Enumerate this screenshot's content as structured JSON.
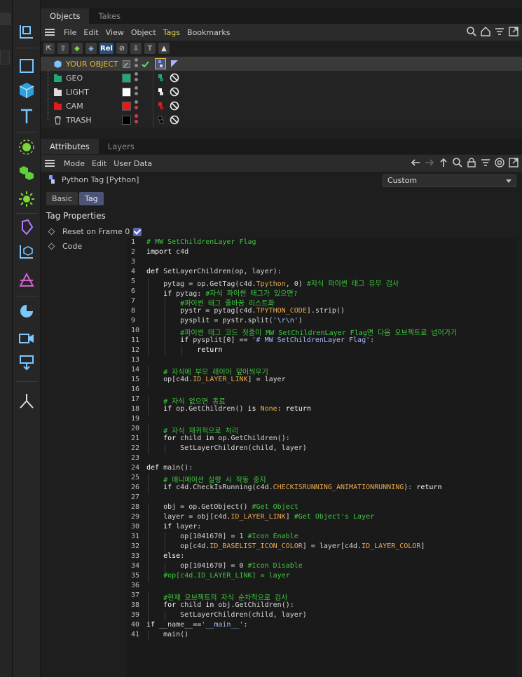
{
  "tabs_top": [
    "Objects",
    "Takes"
  ],
  "obj_menu": [
    "File",
    "Edit",
    "View",
    "Object",
    "Tags",
    "Bookmarks"
  ],
  "obj_toolbar_label": "Rel",
  "objects": [
    {
      "name": "YOUR OBJECT",
      "color": "",
      "selected": true
    },
    {
      "name": "GEO",
      "color": "#1fa87a",
      "selected": false
    },
    {
      "name": "LIGHT",
      "color": "#ffffff",
      "selected": false
    },
    {
      "name": "CAM",
      "color": "#e51b1b",
      "selected": false
    },
    {
      "name": "TRASH",
      "color": "#000000",
      "selected": false
    }
  ],
  "attr_tabs": [
    "Attributes",
    "Layers"
  ],
  "attr_menu": [
    "Mode",
    "Edit",
    "User Data"
  ],
  "tag_title": "Python Tag [Python]",
  "preset": "Custom",
  "subtabs": [
    "Basic",
    "Tag"
  ],
  "section_title": "Tag Properties",
  "props": [
    "Reset on Frame 0",
    "Code"
  ],
  "code_lines": [
    [
      [
        "cm",
        "# MW SetChildrenLayer Flag"
      ]
    ],
    [
      [
        "k",
        "import"
      ],
      [
        "fn",
        " c4d"
      ]
    ],
    [],
    [
      [
        "k",
        "def"
      ],
      [
        "fn",
        " SetLayerChildren(op, layer):"
      ]
    ],
    [
      [
        "fn",
        "    pytag = op.GetTag(c4d."
      ],
      [
        "cst",
        "Tpython"
      ],
      [
        "fn",
        ", 0) "
      ],
      [
        "cm",
        "#자식 파이썬 태그 유무 검사"
      ]
    ],
    [
      [
        "fn",
        "    "
      ],
      [
        "k",
        "if"
      ],
      [
        "fn",
        " pytag: "
      ],
      [
        "cm",
        "#자식 파이썬 태그가 있으면?"
      ]
    ],
    [
      [
        "fn",
        "        "
      ],
      [
        "cm",
        "#파이썬 태그 줄바꿈 리스트화"
      ]
    ],
    [
      [
        "fn",
        "        pystr = pytag[c4d."
      ],
      [
        "cst",
        "TPYTHON_CODE"
      ],
      [
        "fn",
        "].strip()"
      ]
    ],
    [
      [
        "fn",
        "        pysplit = pystr.split("
      ],
      [
        "str",
        "'\\r\\n'"
      ],
      [
        "fn",
        ")"
      ]
    ],
    [
      [
        "fn",
        "        "
      ],
      [
        "cm",
        "#파이썬 태그 코드 첫줄이 MW SetChildrenLayer Flag면 다음 오브젝트로 넘어가기"
      ]
    ],
    [
      [
        "fn",
        "        "
      ],
      [
        "k",
        "if"
      ],
      [
        "fn",
        " pysplit[0] == "
      ],
      [
        "str",
        "'# MW SetChildrenLayer Flag'"
      ],
      [
        "fn",
        ":"
      ]
    ],
    [
      [
        "fn",
        "            "
      ],
      [
        "k",
        "return"
      ]
    ],
    [],
    [
      [
        "fn",
        "    "
      ],
      [
        "cm",
        "# 자식에 부모 레이어 덮어씌우기"
      ]
    ],
    [
      [
        "fn",
        "    op[c4d."
      ],
      [
        "cst",
        "ID_LAYER_LINK"
      ],
      [
        "fn",
        "] = layer"
      ]
    ],
    [],
    [
      [
        "fn",
        "    "
      ],
      [
        "cm",
        "# 자식 없으면 종료"
      ]
    ],
    [
      [
        "fn",
        "    "
      ],
      [
        "k",
        "if"
      ],
      [
        "fn",
        " op.GetChildren() "
      ],
      [
        "k",
        "is"
      ],
      [
        "fn",
        " "
      ],
      [
        "cst",
        "None"
      ],
      [
        "fn",
        ": "
      ],
      [
        "k",
        "return"
      ]
    ],
    [],
    [
      [
        "fn",
        "    "
      ],
      [
        "cm",
        "# 자식 재귀적으로 처리"
      ]
    ],
    [
      [
        "fn",
        "    "
      ],
      [
        "k",
        "for"
      ],
      [
        "fn",
        " child "
      ],
      [
        "k",
        "in"
      ],
      [
        "fn",
        " op.GetChildren():"
      ]
    ],
    [
      [
        "fn",
        "        SetLayerChildren(child, layer)"
      ]
    ],
    [],
    [
      [
        "k",
        "def"
      ],
      [
        "fn",
        " main():"
      ]
    ],
    [
      [
        "fn",
        "    "
      ],
      [
        "cm",
        "# 애니메이션 실행 시 작동 중지"
      ]
    ],
    [
      [
        "fn",
        "    "
      ],
      [
        "k",
        "if"
      ],
      [
        "fn",
        " c4d.CheckIsRunning(c4d."
      ],
      [
        "cst",
        "CHECKISRUNNING_ANIMATIONRUNNING"
      ],
      [
        "fn",
        "): "
      ],
      [
        "k",
        "return"
      ]
    ],
    [],
    [
      [
        "fn",
        "    obj = op.GetObject() "
      ],
      [
        "cm",
        "#Get Object"
      ]
    ],
    [
      [
        "fn",
        "    layer = obj[c4d."
      ],
      [
        "cst",
        "ID_LAYER_LINK"
      ],
      [
        "fn",
        "] "
      ],
      [
        "cm",
        "#Get Object's Layer"
      ]
    ],
    [
      [
        "fn",
        "    "
      ],
      [
        "k",
        "if"
      ],
      [
        "fn",
        " layer:"
      ]
    ],
    [
      [
        "fn",
        "        op[1041670] = 1 "
      ],
      [
        "cm",
        "#Icon Enable"
      ]
    ],
    [
      [
        "fn",
        "        op[c4d."
      ],
      [
        "cst",
        "ID_BASELIST_ICON_COLOR"
      ],
      [
        "fn",
        "] = layer[c4d."
      ],
      [
        "cst",
        "ID_LAYER_COLOR"
      ],
      [
        "fn",
        "]"
      ]
    ],
    [
      [
        "fn",
        "    "
      ],
      [
        "k",
        "else"
      ],
      [
        "fn",
        ":"
      ]
    ],
    [
      [
        "fn",
        "        op[1041670] = 0 "
      ],
      [
        "cm",
        "#Icon Disable"
      ]
    ],
    [
      [
        "fn",
        "    "
      ],
      [
        "cm",
        "#op[c4d.ID_LAYER_LINK] = layer"
      ]
    ],
    [],
    [
      [
        "fn",
        "    "
      ],
      [
        "cm",
        "#현재 오브젝트의 자식 순차적으로 검사"
      ]
    ],
    [
      [
        "fn",
        "    "
      ],
      [
        "k",
        "for"
      ],
      [
        "fn",
        " child "
      ],
      [
        "k",
        "in"
      ],
      [
        "fn",
        " obj.GetChildren():"
      ]
    ],
    [
      [
        "fn",
        "        SetLayerChildren(child, layer)"
      ]
    ],
    [
      [
        "k",
        "if"
      ],
      [
        "fn",
        " __name__=="
      ],
      [
        "str",
        "'__main__'"
      ],
      [
        "fn",
        ":"
      ]
    ],
    [
      [
        "fn",
        "    main()"
      ]
    ]
  ]
}
